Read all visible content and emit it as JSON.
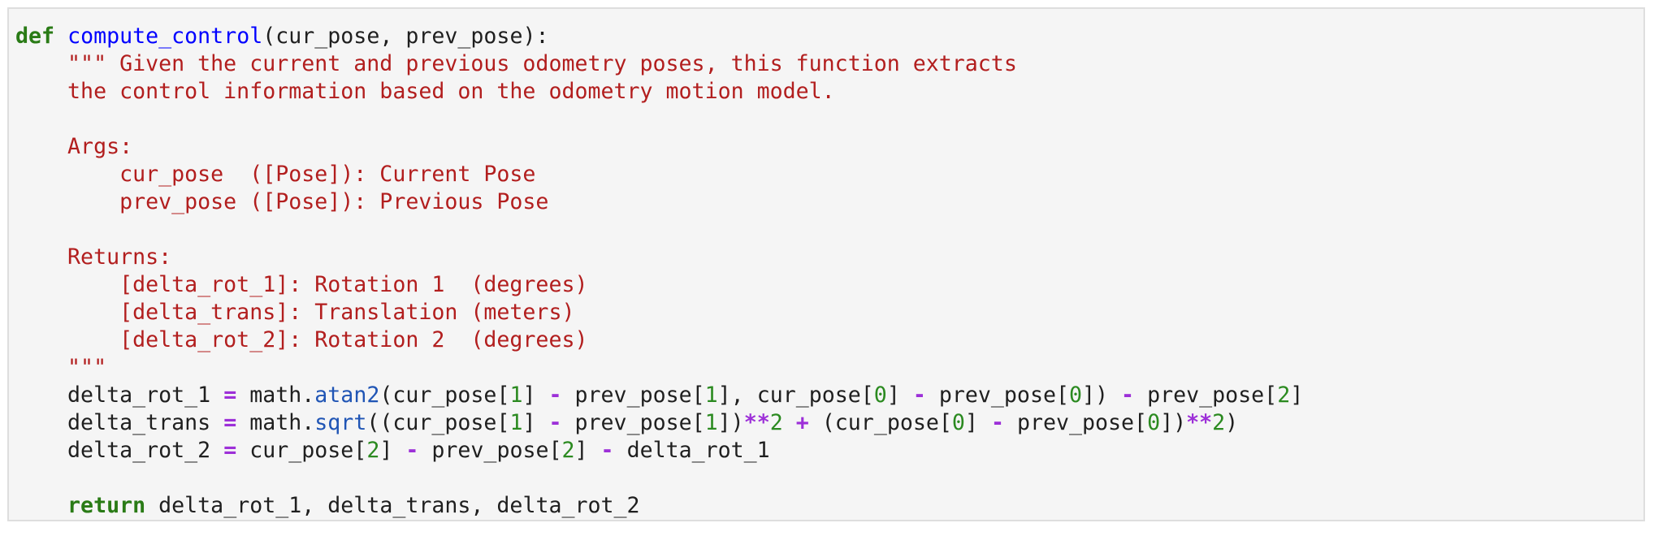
{
  "code_cell": {
    "lines": [
      {
        "tokens": [
          {
            "t": "def",
            "c": "kw"
          },
          {
            "t": " ",
            "c": ""
          },
          {
            "t": "compute_control",
            "c": "fn"
          },
          {
            "t": "(cur_pose, prev_pose):",
            "c": ""
          }
        ]
      },
      {
        "tokens": [
          {
            "t": "    \"\"\" Given the current and previous odometry poses, this function extracts",
            "c": "str"
          }
        ]
      },
      {
        "tokens": [
          {
            "t": "    the control information based on the odometry motion model.",
            "c": "str"
          }
        ]
      },
      {
        "tokens": [
          {
            "t": "",
            "c": ""
          }
        ]
      },
      {
        "tokens": [
          {
            "t": "    Args:",
            "c": "str"
          }
        ]
      },
      {
        "tokens": [
          {
            "t": "        cur_pose  ([Pose]): Current Pose",
            "c": "str"
          }
        ]
      },
      {
        "tokens": [
          {
            "t": "        prev_pose ([Pose]): Previous Pose",
            "c": "str"
          }
        ]
      },
      {
        "tokens": [
          {
            "t": "",
            "c": ""
          }
        ]
      },
      {
        "tokens": [
          {
            "t": "    Returns:",
            "c": "str"
          }
        ]
      },
      {
        "tokens": [
          {
            "t": "        [delta_rot_1]: Rotation 1  (degrees)",
            "c": "str"
          }
        ]
      },
      {
        "tokens": [
          {
            "t": "        [delta_trans]: Translation (meters)",
            "c": "str"
          }
        ]
      },
      {
        "tokens": [
          {
            "t": "        [delta_rot_2]: Rotation 2  (degrees)",
            "c": "str"
          }
        ]
      },
      {
        "tokens": [
          {
            "t": "    \"\"\"",
            "c": "str"
          }
        ]
      },
      {
        "tokens": [
          {
            "t": "    delta_rot_1 ",
            "c": ""
          },
          {
            "t": "=",
            "c": "op"
          },
          {
            "t": " math.",
            "c": ""
          },
          {
            "t": "atan2",
            "c": "mth"
          },
          {
            "t": "(cur_pose[",
            "c": ""
          },
          {
            "t": "1",
            "c": "num"
          },
          {
            "t": "] ",
            "c": ""
          },
          {
            "t": "-",
            "c": "op"
          },
          {
            "t": " prev_pose[",
            "c": ""
          },
          {
            "t": "1",
            "c": "num"
          },
          {
            "t": "], cur_pose[",
            "c": ""
          },
          {
            "t": "0",
            "c": "num"
          },
          {
            "t": "] ",
            "c": ""
          },
          {
            "t": "-",
            "c": "op"
          },
          {
            "t": " prev_pose[",
            "c": ""
          },
          {
            "t": "0",
            "c": "num"
          },
          {
            "t": "]) ",
            "c": ""
          },
          {
            "t": "-",
            "c": "op"
          },
          {
            "t": " prev_pose[",
            "c": ""
          },
          {
            "t": "2",
            "c": "num"
          },
          {
            "t": "]",
            "c": ""
          }
        ]
      },
      {
        "tokens": [
          {
            "t": "    delta_trans ",
            "c": ""
          },
          {
            "t": "=",
            "c": "op"
          },
          {
            "t": " math.",
            "c": ""
          },
          {
            "t": "sqrt",
            "c": "mth"
          },
          {
            "t": "((cur_pose[",
            "c": ""
          },
          {
            "t": "1",
            "c": "num"
          },
          {
            "t": "] ",
            "c": ""
          },
          {
            "t": "-",
            "c": "op"
          },
          {
            "t": " prev_pose[",
            "c": ""
          },
          {
            "t": "1",
            "c": "num"
          },
          {
            "t": "])",
            "c": ""
          },
          {
            "t": "**",
            "c": "op"
          },
          {
            "t": "2",
            "c": "num"
          },
          {
            "t": " ",
            "c": ""
          },
          {
            "t": "+",
            "c": "op"
          },
          {
            "t": " (cur_pose[",
            "c": ""
          },
          {
            "t": "0",
            "c": "num"
          },
          {
            "t": "] ",
            "c": ""
          },
          {
            "t": "-",
            "c": "op"
          },
          {
            "t": " prev_pose[",
            "c": ""
          },
          {
            "t": "0",
            "c": "num"
          },
          {
            "t": "])",
            "c": ""
          },
          {
            "t": "**",
            "c": "op"
          },
          {
            "t": "2",
            "c": "num"
          },
          {
            "t": ")",
            "c": ""
          }
        ]
      },
      {
        "tokens": [
          {
            "t": "    delta_rot_2 ",
            "c": ""
          },
          {
            "t": "=",
            "c": "op"
          },
          {
            "t": " cur_pose[",
            "c": ""
          },
          {
            "t": "2",
            "c": "num"
          },
          {
            "t": "] ",
            "c": ""
          },
          {
            "t": "-",
            "c": "op"
          },
          {
            "t": " prev_pose[",
            "c": ""
          },
          {
            "t": "2",
            "c": "num"
          },
          {
            "t": "] ",
            "c": ""
          },
          {
            "t": "-",
            "c": "op"
          },
          {
            "t": " delta_rot_1",
            "c": ""
          }
        ]
      },
      {
        "tokens": [
          {
            "t": "",
            "c": ""
          }
        ]
      },
      {
        "tokens": [
          {
            "t": "    ",
            "c": ""
          },
          {
            "t": "return",
            "c": "kw"
          },
          {
            "t": " delta_rot_1, delta_trans, delta_rot_2",
            "c": ""
          }
        ]
      }
    ]
  }
}
